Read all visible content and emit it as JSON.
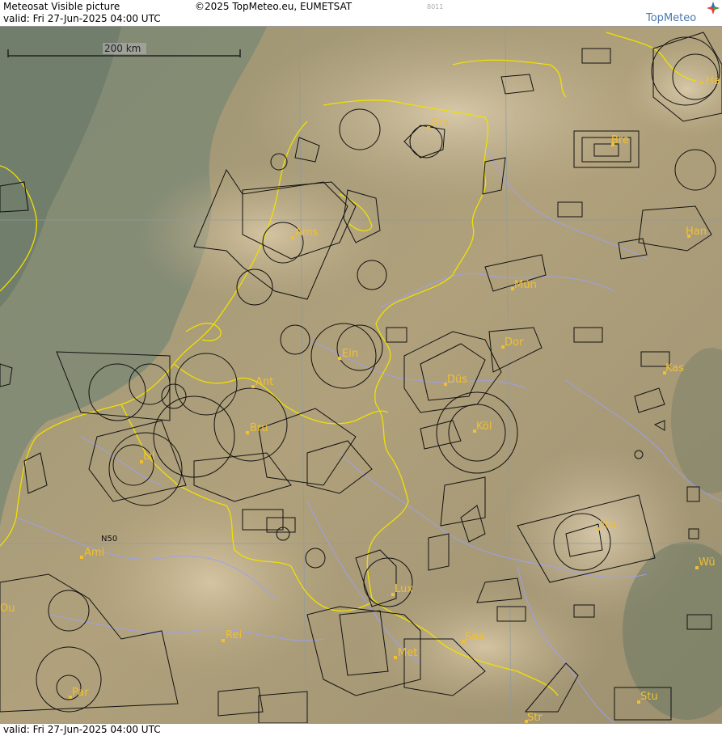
{
  "header": {
    "product_title": "Meteosat Visible picture",
    "copyright": "©2025 TopMeteo.eu, EUMETSAT",
    "image_code": "8011",
    "valid_text": "valid:  Fri  27-Jun-2025  04:00 UTC",
    "logo_text": "TopMeteo"
  },
  "footer": {
    "valid_text": "valid:  Fri  27-Jun-2025  04:00 UTC"
  },
  "map": {
    "scale_label": "200 km",
    "latitude_label": "N50",
    "cities": [
      "Ha",
      "Gro",
      "Bre",
      "Han",
      "Ams",
      "Mün",
      "Dor",
      "Ein",
      "Kas",
      "Ant",
      "Düs",
      "Bru",
      "Köl",
      "Lil",
      "Fra",
      "Ami",
      "Wü",
      "Lux",
      "Ou",
      "Rei",
      "Saa",
      "Met",
      "Par",
      "Stu",
      "Str"
    ]
  },
  "colors": {
    "land_bg": "#a89a78",
    "sea": "#7d8c7a",
    "coast_border": "#f0e000",
    "rivers": "#9aa0ff",
    "airspace": "#111111",
    "city_label": "#f0c030"
  }
}
